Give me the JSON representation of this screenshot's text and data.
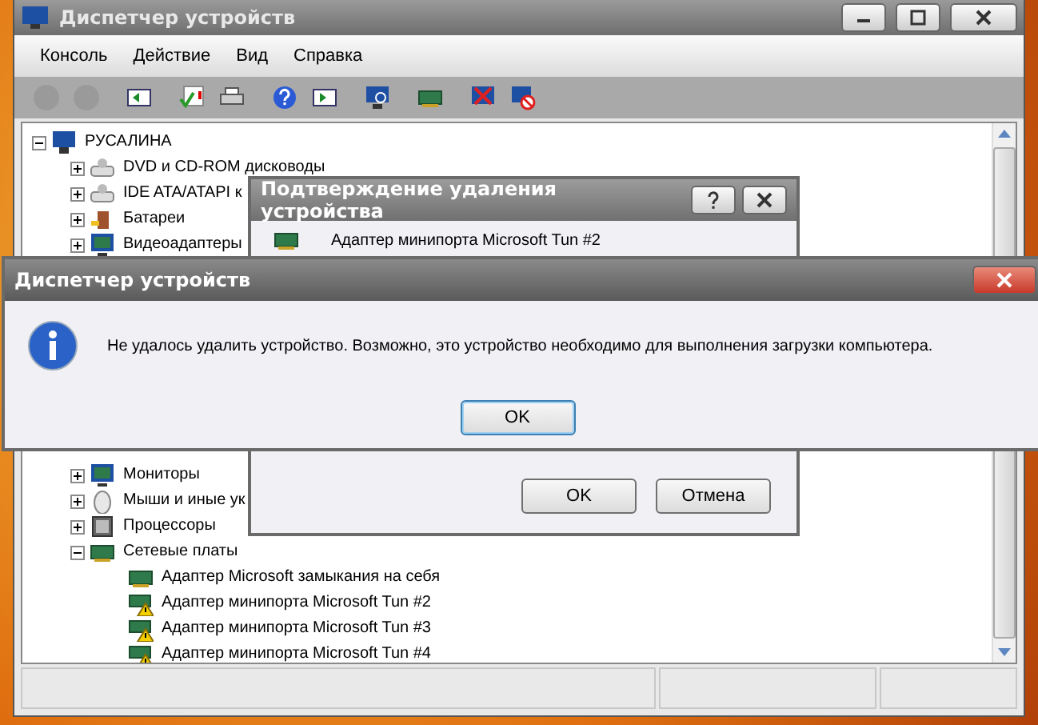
{
  "window": {
    "title": "Диспетчер устройств"
  },
  "menu": [
    "Консоль",
    "Действие",
    "Вид",
    "Справка"
  ],
  "toolbar": [
    {
      "kind": "back",
      "disabled": true
    },
    {
      "kind": "forward",
      "disabled": true
    },
    {
      "kind": "panel",
      "disabled": false
    },
    {
      "kind": "properties",
      "disabled": false
    },
    {
      "kind": "print",
      "disabled": false
    },
    {
      "kind": "help",
      "disabled": false
    },
    {
      "kind": "panel2",
      "disabled": false
    },
    {
      "kind": "scan",
      "disabled": false
    },
    {
      "kind": "card",
      "disabled": false
    },
    {
      "kind": "uninstall",
      "disabled": false
    },
    {
      "kind": "disable",
      "disabled": false
    }
  ],
  "tree": {
    "label": "РУСАЛИНА",
    "expanded": true,
    "children": [
      {
        "label": "DVD и CD-ROM дисководы",
        "expanded": false,
        "kind": "drive"
      },
      {
        "label": "IDE ATA/ATAPI к",
        "expanded": false,
        "kind": "drive"
      },
      {
        "label": "Батареи",
        "expanded": false,
        "kind": "battery"
      },
      {
        "label": "Видеоадаптеры",
        "expanded": false,
        "kind": "monitor"
      },
      {
        "label": "Мониторы",
        "expanded": false,
        "kind": "monitor"
      },
      {
        "label": "Мыши и иные ук",
        "expanded": false,
        "kind": "mouse"
      },
      {
        "label": "Процессоры",
        "expanded": false,
        "kind": "cpu"
      },
      {
        "label": "Сетевые платы",
        "expanded": true,
        "kind": "card",
        "children": [
          {
            "label": "Адаптер Microsoft замыкания на себя",
            "warning": false
          },
          {
            "label": "Адаптер минипорта Microsoft Tun #2",
            "warning": true
          },
          {
            "label": "Адаптер минипорта Microsoft Tun #3",
            "warning": true
          },
          {
            "label": "Адаптер минипорта Microsoft Tun #4",
            "warning": true
          }
        ]
      }
    ]
  },
  "confirm_dialog": {
    "title": "Подтверждение удаления устройства",
    "device": "Адаптер минипорта Microsoft Tun #2",
    "buttons": [
      "OK",
      "Отмена"
    ]
  },
  "error_dialog": {
    "title": "Диспетчер устройств",
    "message": "Не удалось удалить устройство. Возможно, это устройство необходимо для выполнения загрузки компьютера.",
    "button": "OK"
  }
}
